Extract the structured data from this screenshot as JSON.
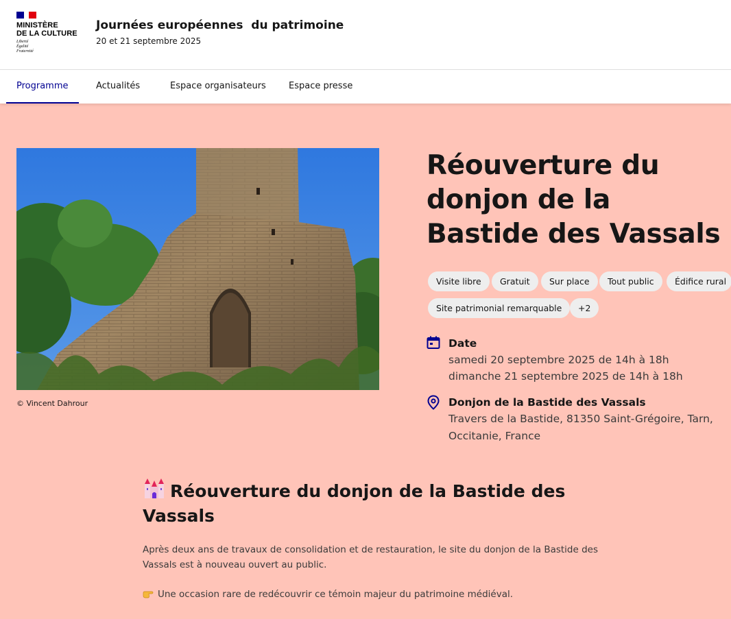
{
  "header": {
    "ministry": "MINISTÈRE\nDE LA CULTURE",
    "devise": [
      "Liberté",
      "Égalité",
      "Fraternité"
    ],
    "title": "Journées européennes  du patrimoine",
    "subtitle": "20 et 21 septembre 2025"
  },
  "nav": {
    "items": [
      {
        "label": "Programme",
        "active": true
      },
      {
        "label": "Actualités",
        "active": false
      },
      {
        "label": "Espace organisateurs",
        "active": false
      },
      {
        "label": "Espace presse",
        "active": false
      }
    ]
  },
  "event": {
    "photo_alt_icon": "castle-tower-photo",
    "photo_credit": "© Vincent Dahrour",
    "title": "Réouverture du donjon de la Bastide des Vassals",
    "tags": [
      "Visite libre",
      "Gratuit",
      "Sur place",
      "Tout public",
      "Édifice rural",
      "Site patrimonial remarquable",
      "+2"
    ],
    "date": {
      "icon": "calendar-icon",
      "label": "Date",
      "lines": [
        "samedi 20 septembre 2025 de 14h à 18h",
        "dimanche 21 septembre 2025 de 14h à 18h"
      ]
    },
    "location": {
      "icon": "map-pin-icon",
      "label": "Donjon de la Bastide des Vassals",
      "lines": [
        "Travers de la Bastide, 81350 Saint-Grégoire, Tarn,",
        "Occitanie, France"
      ]
    }
  },
  "description": {
    "heading": "Réouverture du donjon de la Bastide des Vassals",
    "paragraph1": "Après deux ans de travaux de consolidation et de restauration, le site du donjon de la Bastide des Vassals est à nouveau ouvert au public.",
    "paragraph2": "Une occasion rare de redécouvrir ce témoin majeur du patrimoine médiéval."
  },
  "colors": {
    "accent": "#000091",
    "background": "#ffc4b8",
    "tag_bg": "#eeeeee"
  }
}
